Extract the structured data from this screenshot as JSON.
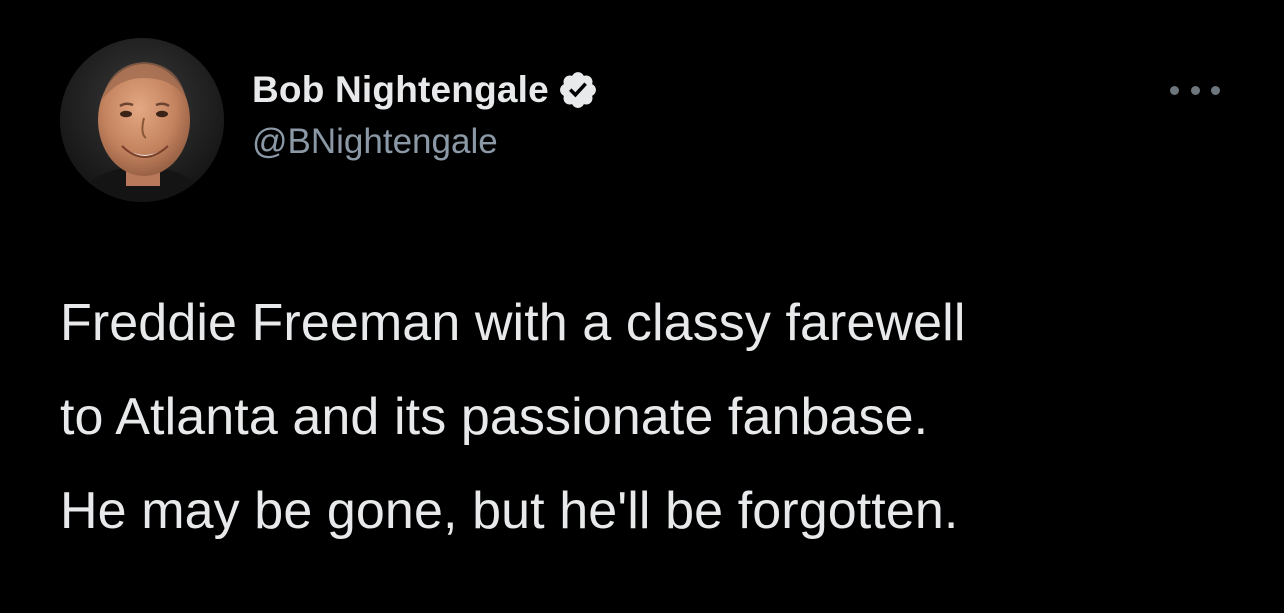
{
  "author": {
    "display_name": "Bob Nightengale",
    "handle": "@BNightengale",
    "verified": true
  },
  "icons": {
    "verified": "verified-badge-icon",
    "more": "more-options-icon"
  },
  "tweet": {
    "lines": [
      "Freddie Freeman with a classy farewell",
      "to Atlanta and its passionate fanbase.",
      "He may be gone, but he'll be forgotten."
    ]
  },
  "colors": {
    "background": "#000000",
    "text": "#e7e9ea",
    "secondary_text": "#8b98a5",
    "badge": "#e7e9ea"
  }
}
